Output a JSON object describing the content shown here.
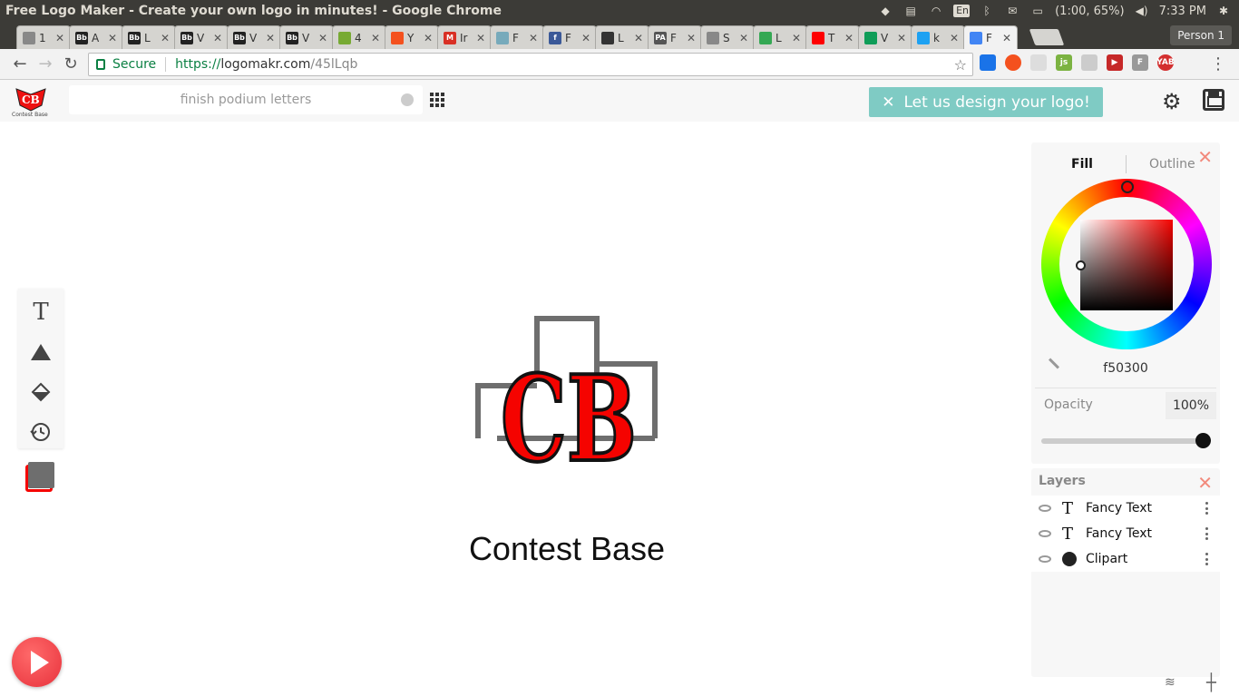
{
  "window": {
    "title": "Free Logo Maker - Create your own logo in minutes! - Google Chrome",
    "battery": "(1:00, 65%)",
    "time": "7:33 PM",
    "lang": "En"
  },
  "tabs": [
    {
      "label": "1",
      "fav": "#888",
      "glyph": ""
    },
    {
      "label": "A",
      "fav": "#222",
      "glyph": "Bb"
    },
    {
      "label": "L",
      "fav": "#222",
      "glyph": "Bb"
    },
    {
      "label": "V",
      "fav": "#222",
      "glyph": "Bb"
    },
    {
      "label": "V",
      "fav": "#222",
      "glyph": "Bb"
    },
    {
      "label": "V",
      "fav": "#222",
      "glyph": "Bb"
    },
    {
      "label": "4",
      "fav": "#7a3",
      "glyph": ""
    },
    {
      "label": "Y",
      "fav": "#f4511e",
      "glyph": ""
    },
    {
      "label": "Ir",
      "fav": "#d93025",
      "glyph": "M"
    },
    {
      "label": "F",
      "fav": "#7ab",
      "glyph": ""
    },
    {
      "label": "F",
      "fav": "#3b5998",
      "glyph": "f"
    },
    {
      "label": "L",
      "fav": "#333",
      "glyph": ""
    },
    {
      "label": "F",
      "fav": "#555",
      "glyph": "PA"
    },
    {
      "label": "S",
      "fav": "#888",
      "glyph": ""
    },
    {
      "label": "L",
      "fav": "#34a853",
      "glyph": ""
    },
    {
      "label": "T",
      "fav": "#ff0000",
      "glyph": ""
    },
    {
      "label": "V",
      "fav": "#0f9d58",
      "glyph": ""
    },
    {
      "label": "k",
      "fav": "#1da1f2",
      "glyph": ""
    },
    {
      "label": "F",
      "fav": "#4285f4",
      "glyph": ""
    }
  ],
  "person": "Person 1",
  "address": {
    "secure": "Secure",
    "proto": "https://",
    "host": "logomakr.com",
    "path": "/45lLqb"
  },
  "app": {
    "search_placeholder": "finish podium letters",
    "design_button": "Let us design your logo!",
    "logo_caption": "Contest Base",
    "mini_logo_caption": "Contest Base",
    "logo_letters": "CB"
  },
  "color_panel": {
    "fill_tab": "Fill",
    "outline_tab": "Outline",
    "hex": "f50300",
    "opacity_label": "Opacity",
    "opacity_value": "100%",
    "accent": "#f50300"
  },
  "layers": {
    "title": "Layers",
    "items": [
      {
        "label": "Fancy Text",
        "kind": "text-icon"
      },
      {
        "label": "Fancy Text",
        "kind": "text-icon"
      },
      {
        "label": "Clipart",
        "kind": "clipart-icon"
      }
    ]
  }
}
